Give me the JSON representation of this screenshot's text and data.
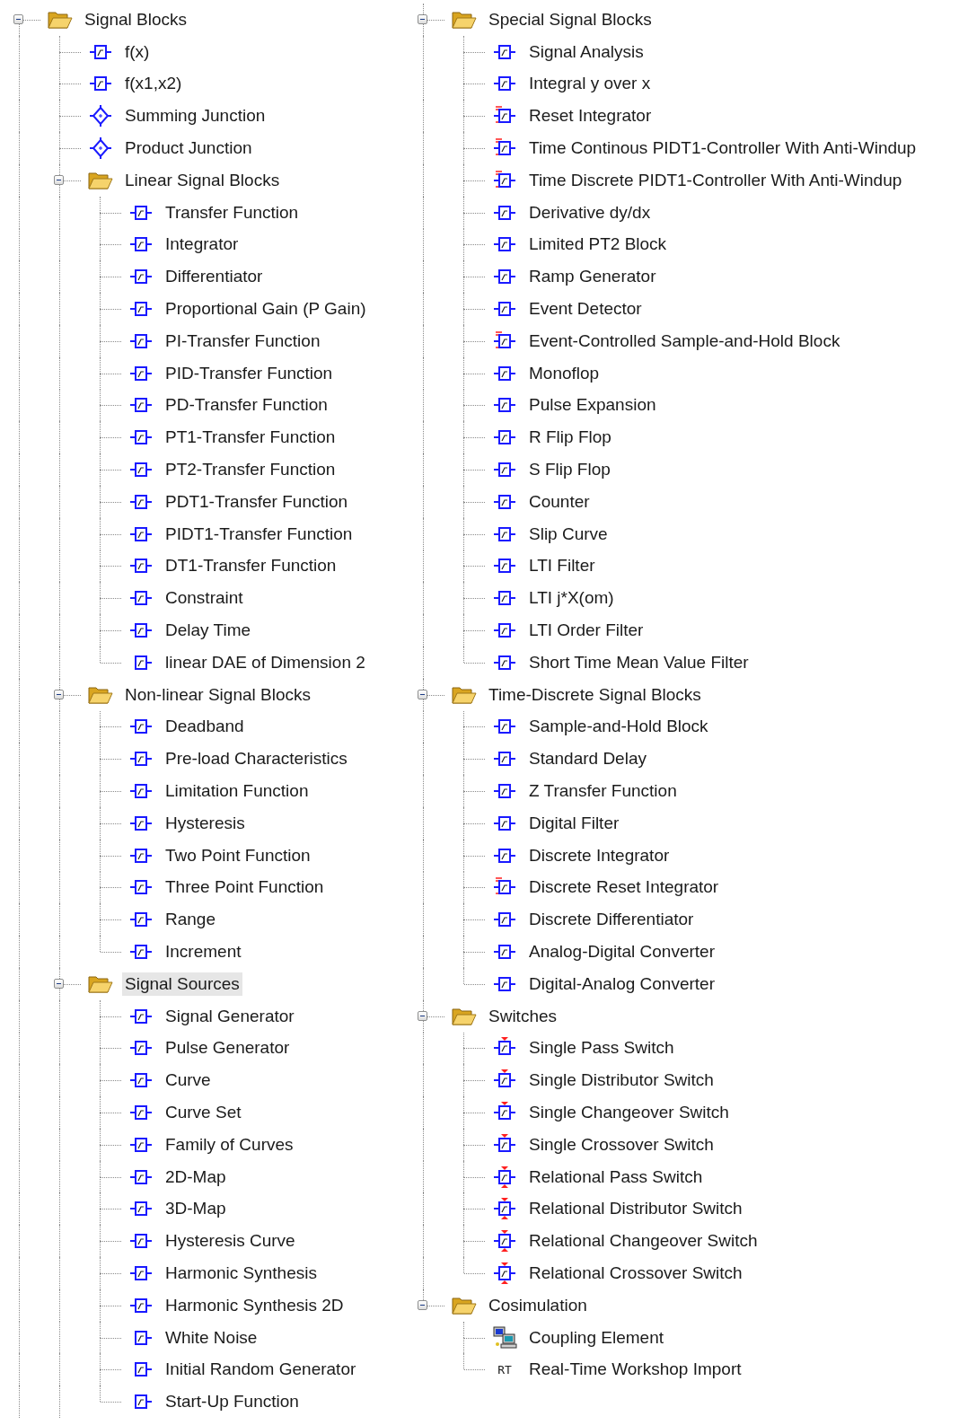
{
  "tree": {
    "label": "Signal Blocks",
    "kind": "folder",
    "expanded": true,
    "selected": false,
    "children": [
      {
        "label": "f(x)",
        "kind": "block",
        "selected": false
      },
      {
        "label": "f(x1,x2)",
        "kind": "block",
        "selected": false
      },
      {
        "label": "Summing Junction",
        "kind": "junction",
        "selected": false
      },
      {
        "label": "Product Junction",
        "kind": "junction",
        "selected": false
      },
      {
        "label": "Linear Signal Blocks",
        "kind": "folder",
        "expanded": true,
        "selected": false,
        "children": [
          {
            "label": "Transfer Function",
            "kind": "block",
            "selected": false
          },
          {
            "label": "Integrator",
            "kind": "block",
            "selected": false
          },
          {
            "label": "Differentiator",
            "kind": "block",
            "selected": false
          },
          {
            "label": "Proportional Gain (P Gain)",
            "kind": "block",
            "selected": false
          },
          {
            "label": "PI-Transfer Function",
            "kind": "block",
            "selected": false
          },
          {
            "label": "PID-Transfer Function",
            "kind": "block",
            "selected": false
          },
          {
            "label": "PD-Transfer Function",
            "kind": "block",
            "selected": false
          },
          {
            "label": "PT1-Transfer Function",
            "kind": "block",
            "selected": false
          },
          {
            "label": "PT2-Transfer Function",
            "kind": "block",
            "selected": false
          },
          {
            "label": "PDT1-Transfer Function",
            "kind": "block",
            "selected": false
          },
          {
            "label": "PIDT1-Transfer Function",
            "kind": "block",
            "selected": false
          },
          {
            "label": "DT1-Transfer Function",
            "kind": "block",
            "selected": false
          },
          {
            "label": "Constraint",
            "kind": "block",
            "selected": false
          },
          {
            "label": "Delay Time",
            "kind": "block",
            "selected": false
          },
          {
            "label": "linear DAE of  Dimension 2",
            "kind": "source-block",
            "selected": false
          }
        ]
      },
      {
        "label": "Non-linear Signal Blocks",
        "kind": "folder",
        "expanded": true,
        "selected": false,
        "children": [
          {
            "label": "Deadband",
            "kind": "block",
            "selected": false
          },
          {
            "label": "Pre-load Characteristics",
            "kind": "block",
            "selected": false
          },
          {
            "label": "Limitation Function",
            "kind": "block",
            "selected": false
          },
          {
            "label": "Hysteresis",
            "kind": "block",
            "selected": false
          },
          {
            "label": "Two Point Function",
            "kind": "block",
            "selected": false
          },
          {
            "label": "Three Point Function",
            "kind": "block",
            "selected": false
          },
          {
            "label": "Range",
            "kind": "block",
            "selected": false
          },
          {
            "label": "Increment",
            "kind": "block",
            "selected": false
          }
        ]
      },
      {
        "label": "Signal Sources",
        "kind": "folder",
        "expanded": true,
        "selected": true,
        "children": [
          {
            "label": "Signal Generator",
            "kind": "block",
            "selected": false
          },
          {
            "label": "Pulse Generator",
            "kind": "block",
            "selected": false
          },
          {
            "label": "Curve",
            "kind": "block",
            "selected": false
          },
          {
            "label": "Curve Set",
            "kind": "block",
            "selected": false
          },
          {
            "label": "Family of Curves",
            "kind": "block",
            "selected": false
          },
          {
            "label": "2D-Map",
            "kind": "block",
            "selected": false
          },
          {
            "label": "3D-Map",
            "kind": "block",
            "selected": false
          },
          {
            "label": "Hysteresis Curve",
            "kind": "block",
            "selected": false
          },
          {
            "label": "Harmonic Synthesis",
            "kind": "block",
            "selected": false
          },
          {
            "label": "Harmonic Synthesis 2D",
            "kind": "block",
            "selected": false
          },
          {
            "label": "White Noise",
            "kind": "source-block",
            "selected": false
          },
          {
            "label": "Initial Random Generator",
            "kind": "source-block",
            "selected": false
          },
          {
            "label": "Start-Up Function",
            "kind": "source-block",
            "selected": false
          }
        ]
      },
      {
        "label": "Special Signal Blocks",
        "kind": "folder",
        "expanded": true,
        "selected": false,
        "children": [
          {
            "label": "Signal Analysis",
            "kind": "block",
            "selected": false
          },
          {
            "label": "Integral y over x",
            "kind": "block",
            "selected": false
          },
          {
            "label": "Reset Integrator",
            "kind": "reset-block",
            "selected": false
          },
          {
            "label": "Time Continous PIDT1-Controller With Anti-Windup",
            "kind": "reset-block",
            "selected": false
          },
          {
            "label": "Time Discrete PIDT1-Controller With Anti-Windup",
            "kind": "reset-block",
            "selected": false
          },
          {
            "label": "Derivative dy/dx",
            "kind": "block",
            "selected": false
          },
          {
            "label": "Limited PT2 Block",
            "kind": "block",
            "selected": false
          },
          {
            "label": "Ramp Generator",
            "kind": "block",
            "selected": false
          },
          {
            "label": "Event Detector",
            "kind": "block",
            "selected": false
          },
          {
            "label": "Event-Controlled Sample-and-Hold Block",
            "kind": "reset-block",
            "selected": false
          },
          {
            "label": "Monoflop",
            "kind": "block",
            "selected": false
          },
          {
            "label": "Pulse Expansion",
            "kind": "block",
            "selected": false
          },
          {
            "label": "R Flip Flop",
            "kind": "block",
            "selected": false
          },
          {
            "label": "S Flip Flop",
            "kind": "block",
            "selected": false
          },
          {
            "label": "Counter",
            "kind": "block",
            "selected": false
          },
          {
            "label": "Slip Curve",
            "kind": "block",
            "selected": false
          },
          {
            "label": "LTI Filter",
            "kind": "block",
            "selected": false
          },
          {
            "label": "LTI j*X(om)",
            "kind": "block",
            "selected": false
          },
          {
            "label": "LTI Order Filter",
            "kind": "block",
            "selected": false
          },
          {
            "label": "Short Time Mean Value Filter",
            "kind": "block",
            "selected": false
          }
        ]
      },
      {
        "label": "Time-Discrete Signal Blocks",
        "kind": "folder",
        "expanded": true,
        "selected": false,
        "children": [
          {
            "label": "Sample-and-Hold Block",
            "kind": "block",
            "selected": false
          },
          {
            "label": "Standard Delay",
            "kind": "block",
            "selected": false
          },
          {
            "label": "Z Transfer Function",
            "kind": "block",
            "selected": false
          },
          {
            "label": "Digital Filter",
            "kind": "block",
            "selected": false
          },
          {
            "label": "Discrete Integrator",
            "kind": "block",
            "selected": false
          },
          {
            "label": "Discrete Reset Integrator",
            "kind": "reset-block",
            "selected": false
          },
          {
            "label": "Discrete Differentiator",
            "kind": "block",
            "selected": false
          },
          {
            "label": "Analog-Digital Converter",
            "kind": "block",
            "selected": false
          },
          {
            "label": "Digital-Analog Converter",
            "kind": "block",
            "selected": false
          }
        ]
      },
      {
        "label": "Switches",
        "kind": "folder",
        "expanded": true,
        "selected": false,
        "children": [
          {
            "label": "Single Pass Switch",
            "kind": "switch",
            "selected": false
          },
          {
            "label": "Single Distributor Switch",
            "kind": "switch",
            "selected": false
          },
          {
            "label": "Single Changeover Switch",
            "kind": "switch",
            "selected": false
          },
          {
            "label": "Single Crossover Switch",
            "kind": "switch",
            "selected": false
          },
          {
            "label": "Relational Pass Switch",
            "kind": "relational-switch",
            "selected": false
          },
          {
            "label": "Relational Distributor Switch",
            "kind": "relational-switch",
            "selected": false
          },
          {
            "label": "Relational Changeover Switch",
            "kind": "relational-switch",
            "selected": false
          },
          {
            "label": "Relational Crossover Switch",
            "kind": "relational-switch",
            "selected": false
          }
        ]
      },
      {
        "label": "Cosimulation",
        "kind": "folder",
        "expanded": true,
        "selected": false,
        "children": [
          {
            "label": "Coupling Element",
            "kind": "coupling",
            "selected": false
          },
          {
            "label": "Real-Time Workshop Import",
            "kind": "rtw",
            "icon_label": "RT",
            "selected": false
          }
        ]
      }
    ]
  }
}
